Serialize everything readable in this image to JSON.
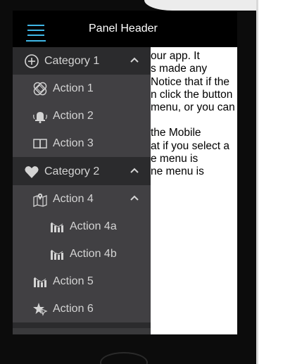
{
  "header": {
    "title": "Panel Header",
    "menu_icon": "hamburger-icon",
    "accent": "#3fb7e6"
  },
  "content": {
    "paragraphs": [
      [
        "our app. It",
        "s made any",
        "Notice that if the",
        "n click the button",
        "menu, or you can"
      ],
      [
        "the Mobile",
        "at if you select a",
        "e menu is",
        "ne menu is"
      ]
    ]
  },
  "menu": {
    "category1": {
      "label": "Category 1",
      "icon": "plus-circle-icon",
      "expanded": true
    },
    "action1": {
      "label": "Action 1",
      "icon": "bandage-icon"
    },
    "action2": {
      "label": "Action 2",
      "icon": "bell-icon"
    },
    "action3": {
      "label": "Action 3",
      "icon": "book-icon"
    },
    "category2": {
      "label": "Category 2",
      "icon": "heart-icon",
      "expanded": true
    },
    "action4": {
      "label": "Action 4",
      "icon": "map-pin-icon",
      "expanded": true
    },
    "action4a": {
      "label": "Action 4a",
      "icon": "bar-chart-icon"
    },
    "action4b": {
      "label": "Action 4b",
      "icon": "bar-chart-icon"
    },
    "action5": {
      "label": "Action 5",
      "icon": "bar-chart-icon"
    },
    "action6": {
      "label": "Action 6",
      "icon": "star-cursor-icon"
    }
  }
}
